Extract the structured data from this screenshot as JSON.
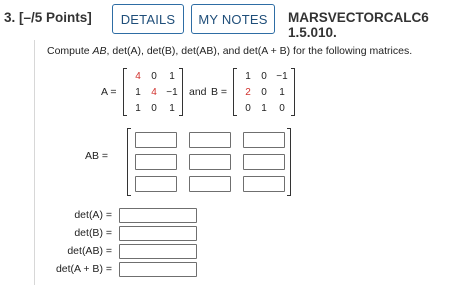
{
  "header": {
    "question_number": "3.",
    "points": "[–/5 Points]",
    "details_label": "DETAILS",
    "notes_label": "MY NOTES",
    "source": "MARSVECTORCALC6 1.5.010."
  },
  "prompt": {
    "before": "Compute ",
    "items": [
      "AB",
      "det(A)",
      "det(B)",
      "det(AB)",
      "det(A + B)"
    ],
    "after": " for the following matrices."
  },
  "matrix_a": {
    "label": "A =",
    "rows": [
      [
        "4",
        "0",
        "1"
      ],
      [
        "1",
        "4",
        "−1"
      ],
      [
        "1",
        "0",
        "1"
      ]
    ],
    "red_cells": [
      "0-0",
      "1-1"
    ]
  },
  "connector": "and",
  "matrix_b": {
    "label": "B =",
    "rows": [
      [
        "1",
        "0",
        "−1"
      ],
      [
        "2",
        "0",
        "1"
      ],
      [
        "0",
        "1",
        "0"
      ]
    ],
    "red_cells": [
      "1-0"
    ]
  },
  "ab": {
    "label": "AB ="
  },
  "determinants": [
    {
      "label": "det(A) =",
      "value": ""
    },
    {
      "label": "det(B) =",
      "value": ""
    },
    {
      "label": "det(AB) =",
      "value": ""
    },
    {
      "label": "det(A + B) =",
      "value": ""
    }
  ],
  "colors": {
    "accent": "#2e6da4",
    "red_entry": "#d0312d"
  }
}
